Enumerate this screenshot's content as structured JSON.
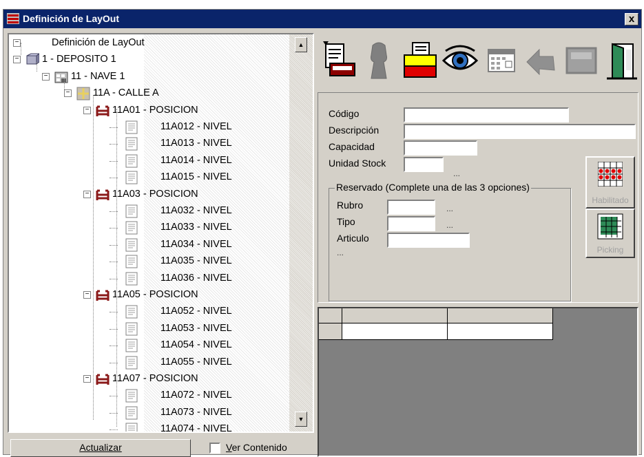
{
  "window": {
    "title": "Definición de LayOut",
    "close_label": "x"
  },
  "tree": {
    "nodes": [
      {
        "label": "Definición de LayOut",
        "type": "root"
      },
      {
        "label": "1 - DEPOSITO 1",
        "type": "deposito"
      },
      {
        "label": "11 - NAVE 1",
        "type": "nave"
      },
      {
        "label": "11A - CALLE A",
        "type": "calle"
      },
      {
        "label": "11A01 - POSICION",
        "type": "posicion"
      },
      {
        "label": "11A012 - NIVEL",
        "type": "nivel"
      },
      {
        "label": "11A013 - NIVEL",
        "type": "nivel"
      },
      {
        "label": "11A014 - NIVEL",
        "type": "nivel"
      },
      {
        "label": "11A015 - NIVEL",
        "type": "nivel"
      },
      {
        "label": "11A03 - POSICION",
        "type": "posicion"
      },
      {
        "label": "11A032 - NIVEL",
        "type": "nivel"
      },
      {
        "label": "11A033 - NIVEL",
        "type": "nivel"
      },
      {
        "label": "11A034 - NIVEL",
        "type": "nivel"
      },
      {
        "label": "11A035 - NIVEL",
        "type": "nivel"
      },
      {
        "label": "11A036 - NIVEL",
        "type": "nivel"
      },
      {
        "label": "11A05 - POSICION",
        "type": "posicion"
      },
      {
        "label": "11A052 - NIVEL",
        "type": "nivel"
      },
      {
        "label": "11A053 - NIVEL",
        "type": "nivel"
      },
      {
        "label": "11A054 - NIVEL",
        "type": "nivel"
      },
      {
        "label": "11A055 - NIVEL",
        "type": "nivel"
      },
      {
        "label": "11A07 - POSICION",
        "type": "posicion"
      },
      {
        "label": "11A072 - NIVEL",
        "type": "nivel"
      },
      {
        "label": "11A073 - NIVEL",
        "type": "nivel"
      },
      {
        "label": "11A074 - NIVEL",
        "type": "nivel"
      }
    ]
  },
  "buttons": {
    "actualizar": "Actualizar"
  },
  "checkbox": {
    "ver_contenido": "Ver Contenido",
    "checked": false
  },
  "toolbar": {
    "icons": [
      "print-preview-icon",
      "person-icon",
      "printer-icon",
      "eye-icon",
      "calendar-icon",
      "back-arrow-icon",
      "stop-icon",
      "exit-door-icon"
    ]
  },
  "form": {
    "codigo_label": "Código",
    "descripcion_label": "Descripción",
    "capacidad_label": "Capacidad",
    "unidad_stock_label": "Unidad Stock",
    "unidad_dots": "...",
    "codigo_value": "",
    "descripcion_value": "",
    "capacidad_value": "",
    "unidad_stock_value": "",
    "reservado": {
      "title": "Reservado (Complete una de las 3 opciones)",
      "rubro_label": "Rubro",
      "tipo_label": "Tipo",
      "articulo_label": "Articulo",
      "rubro_dots": "...",
      "tipo_dots": "...",
      "articulo_dots": "..."
    }
  },
  "side_buttons": {
    "habilitado": "Habilitado",
    "picking": "Picking"
  },
  "colors": {
    "title_bar": "#0a246a",
    "face": "#d4d0c8",
    "posicion_icon": "#8b1a1a"
  }
}
